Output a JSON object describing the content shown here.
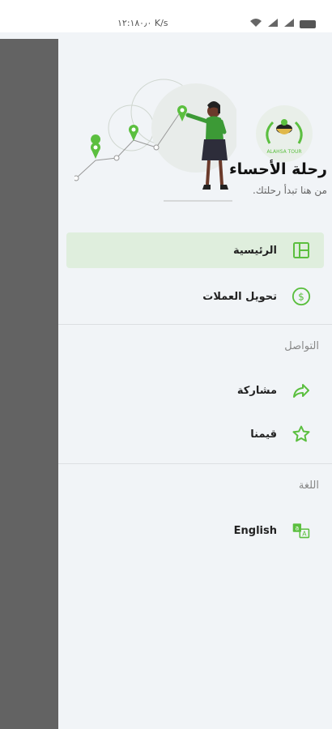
{
  "status_bar": {
    "time": "١٢:١٨",
    "network": "٠٫٠ K/s"
  },
  "drawer": {
    "logo_text": "ALAHSA TOUR",
    "title": "رحلة الأحساء",
    "subtitle": "من هنا تبدأ رحلتك."
  },
  "menu": {
    "items": [
      {
        "label": "الرئيسية",
        "icon": "dashboard-icon",
        "active": true
      },
      {
        "label": "تحويل العملات",
        "icon": "currency-icon",
        "active": false
      }
    ],
    "contact_section": "التواصل",
    "contact_items": [
      {
        "label": "مشاركة",
        "icon": "share-icon"
      },
      {
        "label": "قيمنا",
        "icon": "star-icon"
      }
    ],
    "language_section": "اللغة",
    "language_item": {
      "label": "English",
      "icon": "translate-icon"
    }
  },
  "colors": {
    "accent": "#5bbf3f",
    "active_bg": "#dfeedd",
    "drawer_bg": "#f1f4f7",
    "scrim": "#636363"
  }
}
